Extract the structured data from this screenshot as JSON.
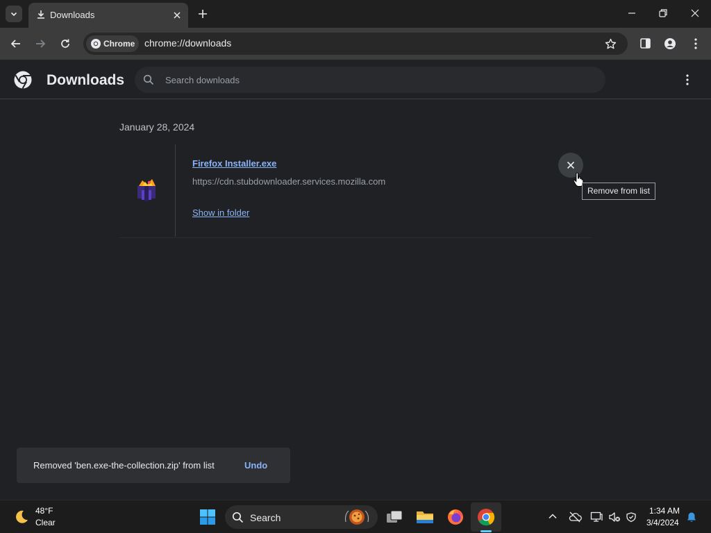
{
  "browser": {
    "tab": {
      "title": "Downloads"
    },
    "omnibox": {
      "chip_label": "Chrome",
      "url": "chrome://downloads"
    }
  },
  "downloads": {
    "title": "Downloads",
    "search_placeholder": "Search downloads",
    "groups": [
      {
        "date": "January 28, 2024",
        "items": [
          {
            "file_name": "Firefox Installer.exe",
            "source_url": "https://cdn.stubdownloader.services.mozilla.com",
            "action": "Show in folder"
          }
        ]
      }
    ],
    "remove_tooltip": "Remove from list"
  },
  "toast": {
    "message": "Removed 'ben.exe-the-collection.zip' from list",
    "action": "Undo"
  },
  "taskbar": {
    "weather": {
      "temp": "48°F",
      "condition": "Clear"
    },
    "search_label": "Search",
    "clock": {
      "time": "1:34 AM",
      "date": "3/4/2024"
    }
  },
  "colors": {
    "accent_link": "#8ab4f8",
    "background": "#202124",
    "taskbar_active": "#60cdff"
  }
}
